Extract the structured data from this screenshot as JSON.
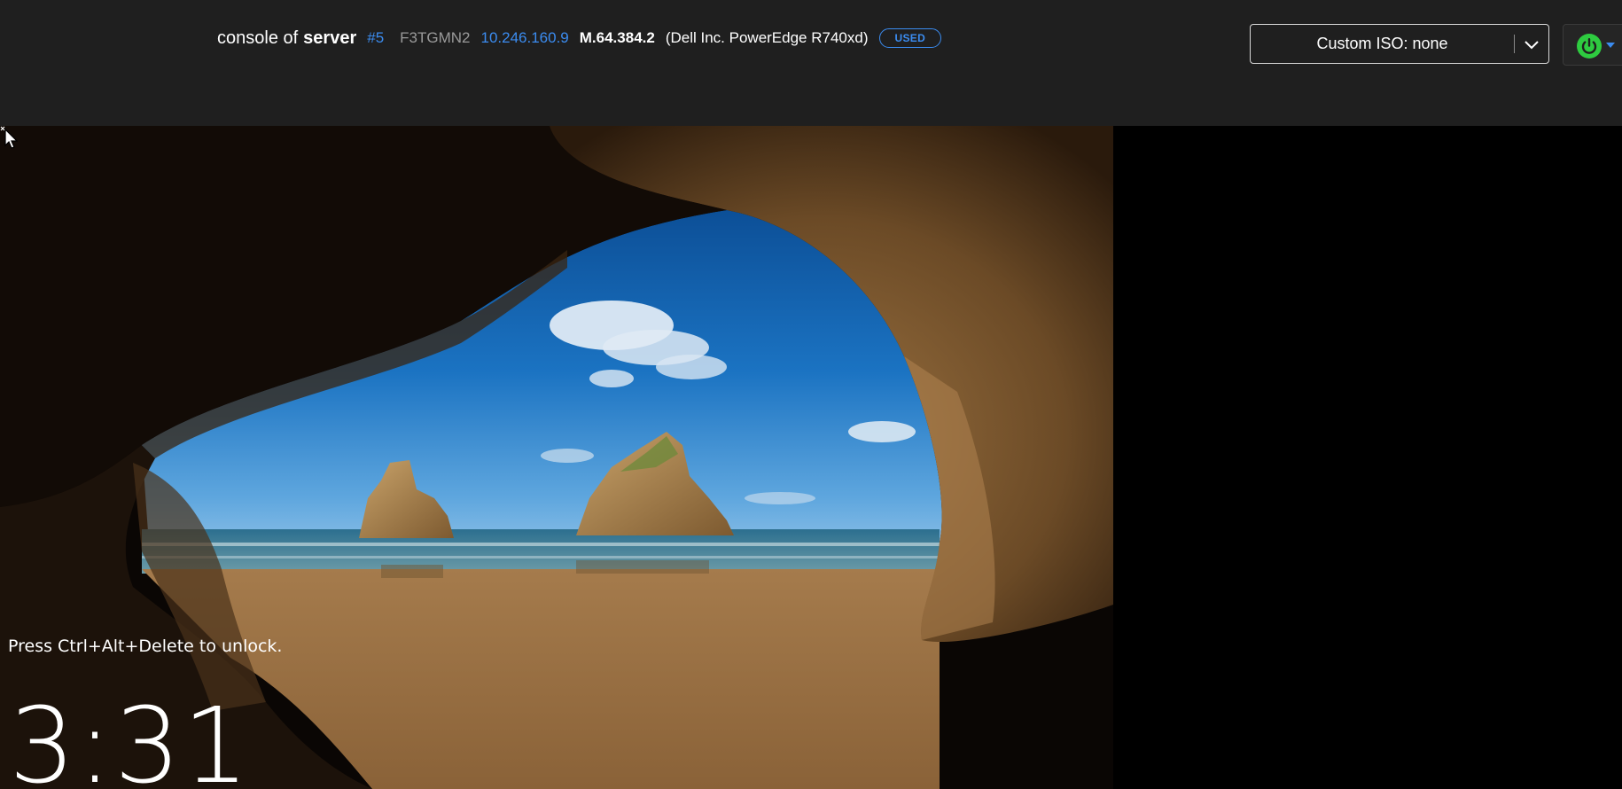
{
  "header": {
    "console_of": "console of",
    "server_label": "server",
    "server_number": "#5",
    "service_tag": "F3TGMN2",
    "ip_address": "10.246.160.9",
    "model_code": "M.64.384.2",
    "hardware": "(Dell Inc. PowerEdge R740xd)",
    "status_badge": "USED",
    "status_color": "#3b8cf0"
  },
  "iso_select": {
    "selected": "Custom ISO: none",
    "icon": "chevron-down-icon"
  },
  "power": {
    "icon": "power-icon",
    "state_color": "#2ecc40",
    "menu_icon": "caret-down-icon"
  },
  "lock_screen": {
    "unlock_hint": "Press Ctrl+Alt+Delete to unlock.",
    "time": "3:31"
  }
}
